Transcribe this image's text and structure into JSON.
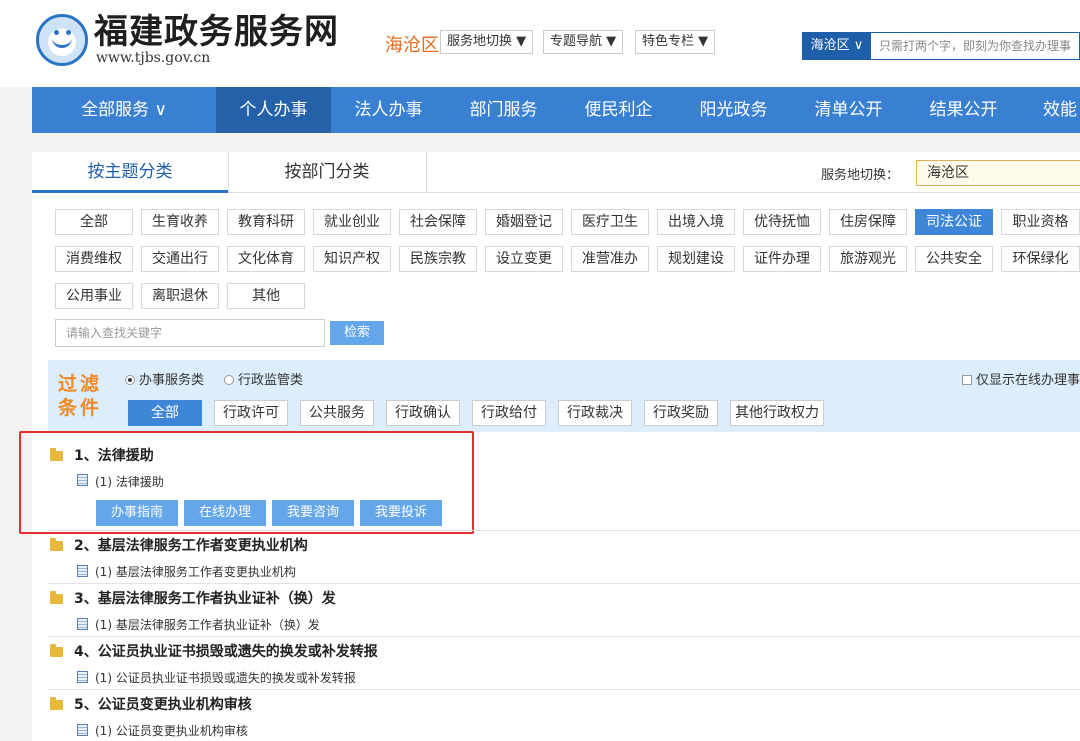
{
  "header": {
    "site_title": "福建政务服务网",
    "site_url": "www.tjbs.gov.cn",
    "region": "海沧区",
    "dropdowns": [
      "服务地切换 ▼",
      "专题导航 ▼",
      "特色专栏 ▼"
    ],
    "search_region": "海沧区 ∨",
    "search_placeholder": "只需打两个字，即刻为你查找办理事"
  },
  "nav": {
    "items": [
      "全部服务 ∨",
      "个人办事",
      "法人办事",
      "部门服务",
      "便民利企",
      "阳光政务",
      "清单公开",
      "结果公开",
      "效能"
    ],
    "active_index": 1
  },
  "tabs": [
    "按主题分类",
    "按部门分类"
  ],
  "location": {
    "label": "服务地切换：",
    "value": "海沧区"
  },
  "categories": [
    [
      "全部",
      "生育收养",
      "教育科研",
      "就业创业",
      "社会保障",
      "婚姻登记",
      "医疗卫生",
      "出境入境",
      "优待抚恤",
      "住房保障",
      "司法公证",
      "职业资格"
    ],
    [
      "消费维权",
      "交通出行",
      "文化体育",
      "知识产权",
      "民族宗教",
      "设立变更",
      "准营准办",
      "规划建设",
      "证件办理",
      "旅游观光",
      "公共安全",
      "环保绿化"
    ],
    [
      "公用事业",
      "离职退休",
      "其他"
    ]
  ],
  "active_category": "司法公证",
  "keyword": {
    "placeholder": "请输入查找关键字",
    "button": "检索"
  },
  "filter": {
    "title": "过滤条件",
    "radio1": "办事服务类",
    "radio2": "行政监管类",
    "online_only": "仅显示在线办理事",
    "types": [
      "全部",
      "行政许可",
      "公共服务",
      "行政确认",
      "行政给付",
      "行政裁决",
      "行政奖励",
      "其他行政权力"
    ]
  },
  "items": [
    {
      "title": "1、法律援助",
      "sub": "(1) 法律援助"
    },
    {
      "title": "2、基层法律服务工作者变更执业机构",
      "sub": "(1) 基层法律服务工作者变更执业机构"
    },
    {
      "title": "3、基层法律服务工作者执业证补（换）发",
      "sub": "(1) 基层法律服务工作者执业证补（换）发"
    },
    {
      "title": "4、公证员执业证书损毁或遗失的换发或补发转报",
      "sub": "(1) 公证员执业证书损毁或遗失的换发或补发转报"
    },
    {
      "title": "5、公证员变更执业机构审核",
      "sub": "(1) 公证员变更执业机构审核"
    }
  ],
  "item_actions": [
    "办事指南",
    "在线办理",
    "我要咨询",
    "我要投诉"
  ]
}
